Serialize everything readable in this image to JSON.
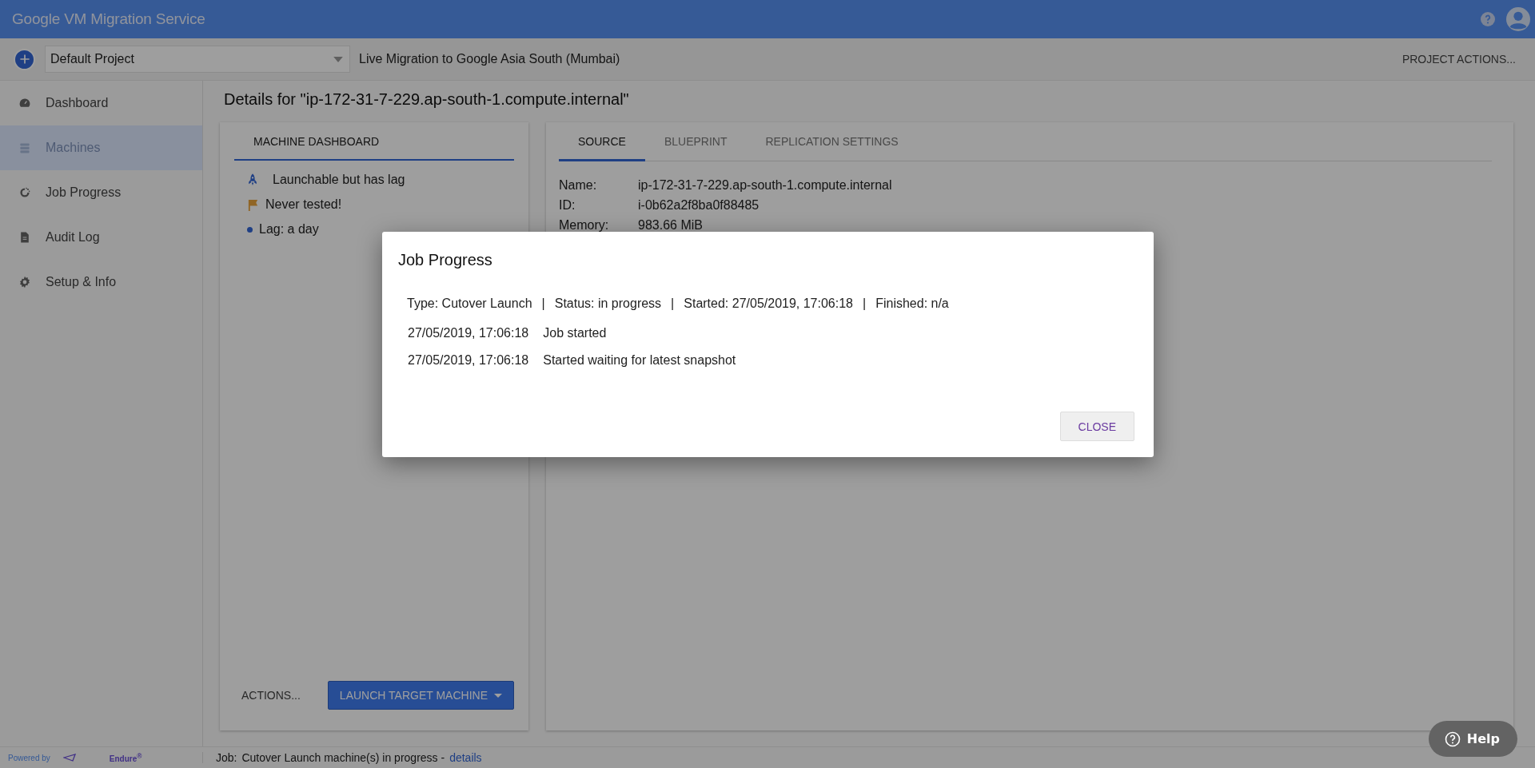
{
  "app": {
    "title": "Google VM Migration Service"
  },
  "project_bar": {
    "project": "Default Project",
    "migration": "Live Migration to Google Asia South (Mumbai)",
    "actions": "PROJECT ACTIONS..."
  },
  "sidebar": {
    "items": [
      {
        "label": "Dashboard",
        "kind": "gauge",
        "selected": false
      },
      {
        "label": "Machines",
        "kind": "list",
        "selected": true
      },
      {
        "label": "Job Progress",
        "kind": "progress",
        "selected": false
      },
      {
        "label": "Audit Log",
        "kind": "document",
        "selected": false
      },
      {
        "label": "Setup & Info",
        "kind": "gear",
        "selected": false
      }
    ]
  },
  "page_title": "Details for \"ip-172-31-7-229.ap-south-1.compute.internal\"",
  "machine_card": {
    "tabs": [
      {
        "label": "MACHINE DASHBOARD",
        "selected": true
      }
    ],
    "statuses": [
      {
        "kind": "rocket",
        "text": "Launchable but has lag"
      },
      {
        "kind": "flag",
        "text": "Never tested!"
      },
      {
        "kind": "dot",
        "text": "Lag: a day"
      }
    ],
    "actions_button": "ACTIONS...",
    "launch_button": "LAUNCH TARGET MACHINE"
  },
  "source_card": {
    "tabs": [
      {
        "label": "SOURCE",
        "selected": true
      },
      {
        "label": "BLUEPRINT",
        "selected": false
      },
      {
        "label": "REPLICATION SETTINGS",
        "selected": false
      }
    ],
    "fields": [
      {
        "label": "Name:",
        "value": "ip-172-31-7-229.ap-south-1.compute.internal"
      },
      {
        "label": "ID:",
        "value": "i-0b62a2f8ba0f88485"
      },
      {
        "label": "Memory:",
        "value": "983.66 MiB"
      }
    ]
  },
  "dialog": {
    "title": "Job Progress",
    "separator": "|",
    "summary": [
      "Type: Cutover Launch",
      "Status: in progress",
      "Started: 27/05/2019, 17:06:18",
      "Finished: n/a"
    ],
    "events": [
      {
        "time": "27/05/2019, 17:06:18",
        "text": "Job started"
      },
      {
        "time": "27/05/2019, 17:06:18",
        "text": "Started waiting for latest snapshot"
      }
    ],
    "close_button": "CLOSE"
  },
  "status_bar": {
    "powered_by": "Powered by",
    "brand": "Endure$^{®}$",
    "job_label": "Job:",
    "job_text": "Cutover Launch machine(s) in progress -",
    "details_link": "details"
  },
  "help_button": "Help"
}
